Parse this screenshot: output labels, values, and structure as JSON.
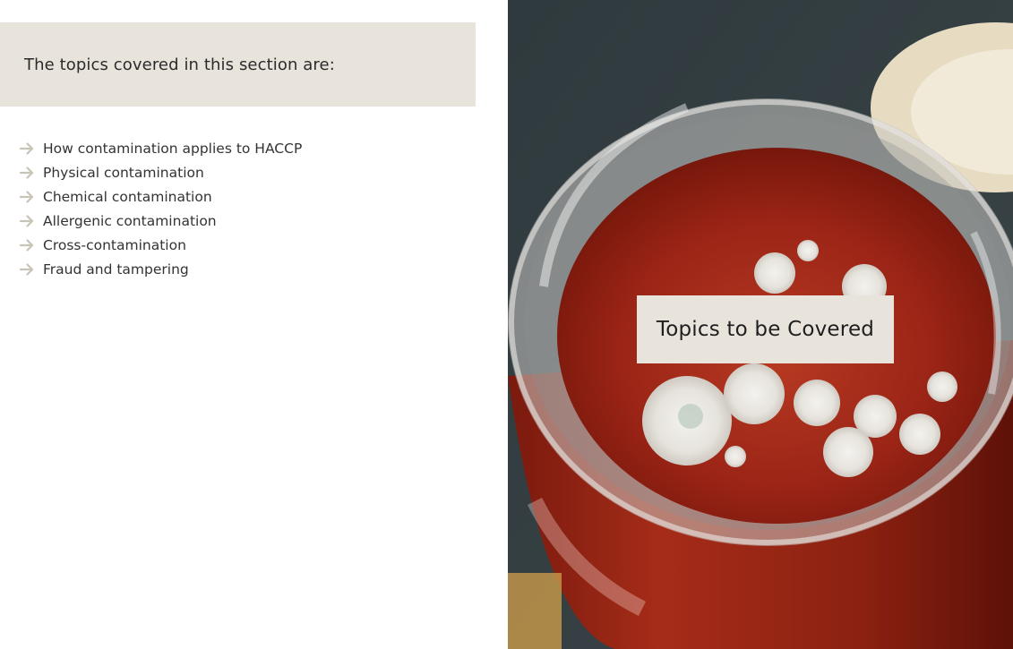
{
  "intro": {
    "text": "The topics covered in this section are:"
  },
  "topics": [
    {
      "label": "How contamination applies to HACCP",
      "icon": "arrow-right-icon"
    },
    {
      "label": "Physical contamination",
      "icon": "arrow-right-icon"
    },
    {
      "label": "Chemical contamination",
      "icon": "arrow-right-icon"
    },
    {
      "label": "Allergenic contamination",
      "icon": "arrow-right-icon"
    },
    {
      "label": "Cross-contamination",
      "icon": "arrow-right-icon"
    },
    {
      "label": "Fraud and tampering",
      "icon": "arrow-right-icon"
    }
  ],
  "image": {
    "overlay_label": "Topics to be Covered"
  },
  "colors": {
    "panel_beige": "#e8e4dc",
    "arrow": "#c8c4b6",
    "text": "#333333"
  }
}
